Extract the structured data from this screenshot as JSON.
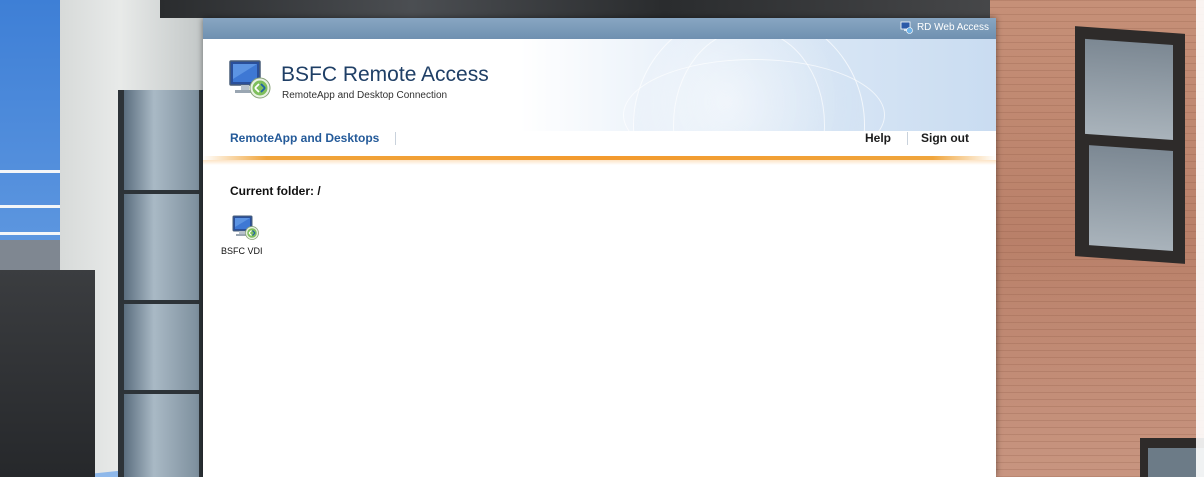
{
  "window": {
    "title": "BSFC Remote Access",
    "subtitle": "RemoteApp and Desktop Connection"
  },
  "topbar": {
    "rd_link_label": "RD Web Access",
    "rd_icon": "rd-web-access-icon"
  },
  "nav": {
    "primary_label": "RemoteApp and Desktops",
    "help_label": "Help",
    "signout_label": "Sign out"
  },
  "content": {
    "current_folder": "Current folder: /",
    "items": [
      {
        "label": "BSFC VDI",
        "icon": "remote-desktop-icon"
      }
    ]
  },
  "colors": {
    "accent_orange": "#f39a2d",
    "nav_link": "#245a99",
    "title_text": "#1f3f66",
    "topbar": "#7a99b7"
  }
}
